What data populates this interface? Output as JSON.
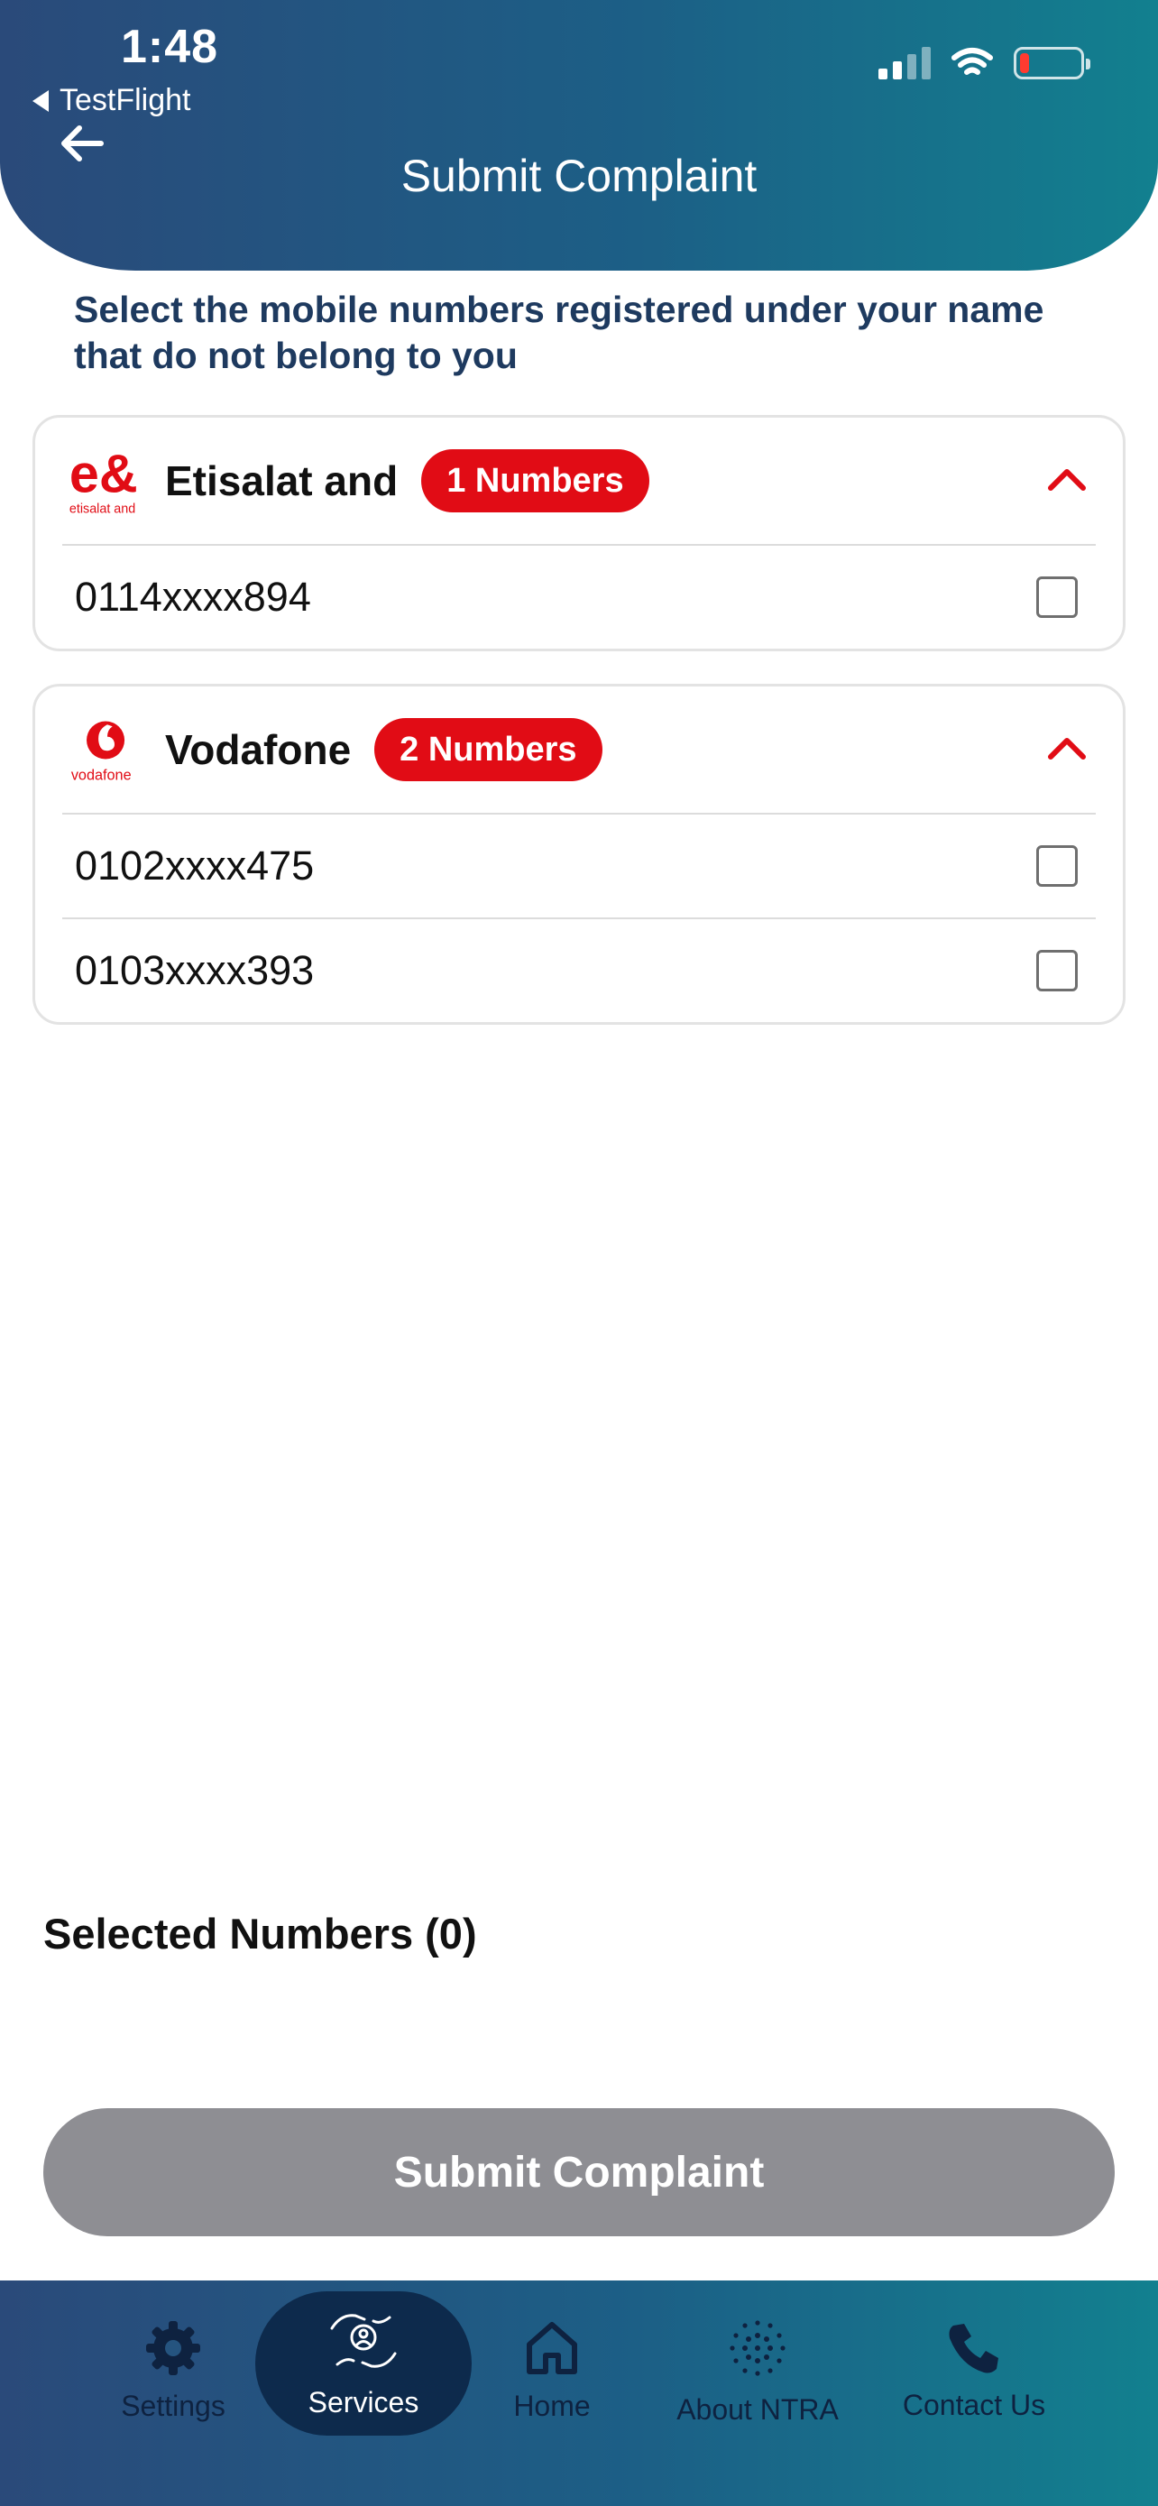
{
  "status_bar": {
    "time": "1:48",
    "back_app": "TestFlight"
  },
  "header": {
    "title": "Submit Complaint"
  },
  "instruction": "Select the mobile numbers registered under your name that do not belong to you",
  "operators": [
    {
      "name": "Etisalat and",
      "badge": "1 Numbers",
      "logo_text": "etisalat and",
      "numbers": [
        "0114xxxx894"
      ]
    },
    {
      "name": "Vodafone",
      "badge": "2 Numbers",
      "logo_text": "vodafone",
      "numbers": [
        "0102xxxx475",
        "0103xxxx393"
      ]
    }
  ],
  "selected_label": "Selected Numbers (0)",
  "submit_label": "Submit Complaint",
  "nav": [
    {
      "label": "Settings",
      "icon": "gear-icon"
    },
    {
      "label": "Services",
      "icon": "services-icon",
      "active": true
    },
    {
      "label": "Home",
      "icon": "home-icon"
    },
    {
      "label": "About NTRA",
      "icon": "ntra-logo-icon"
    },
    {
      "label": "Contact Us",
      "icon": "phone-icon"
    }
  ],
  "colors": {
    "header_start": "#2a4a7a",
    "header_end": "#12808f",
    "badge": "#e10c15",
    "submit_disabled": "#8e8e93",
    "nav_active": "#0d2a4c"
  }
}
